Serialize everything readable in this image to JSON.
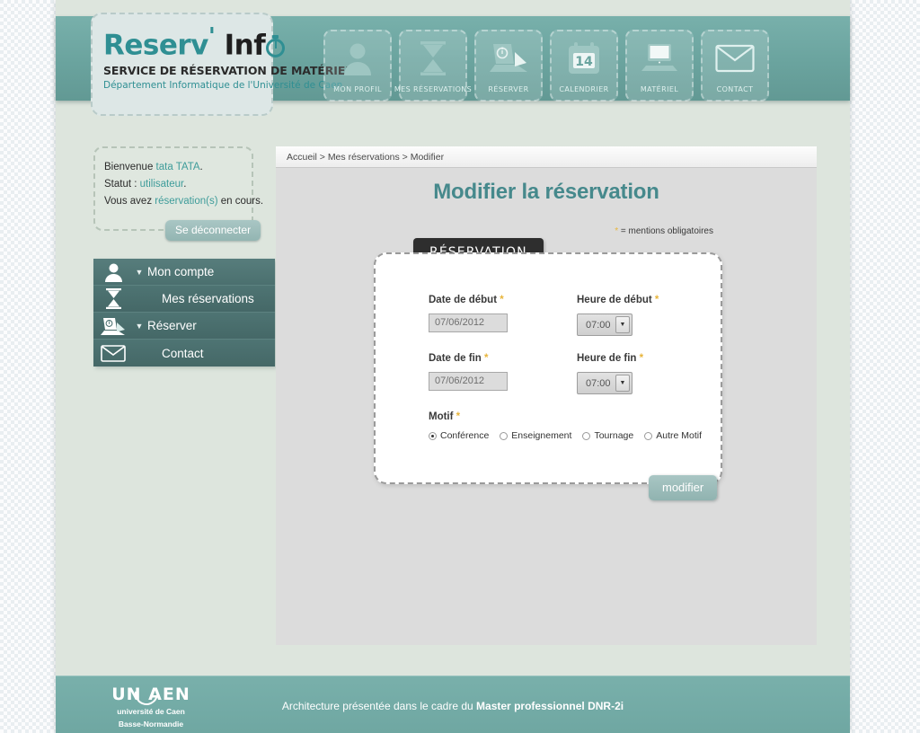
{
  "site": {
    "logo_title_prefix": "Reserv",
    "logo_apostrophe": "'",
    "logo_title_suffix": "Inf",
    "tagline": "SERVICE DE RÉSERVATION DE MATÉRIEL",
    "subtitle": "Département Informatique de l'Université de Caen",
    "accent_color": "#2f8f93",
    "header_color": "#6ba49f",
    "title_color": "#46898c",
    "required_star_color": "#e8b53c"
  },
  "topnav": {
    "items": [
      {
        "label": "Mon profil",
        "icon": "user-icon"
      },
      {
        "label": "Mes réservations",
        "icon": "hourglass-icon"
      },
      {
        "label": "Réserver",
        "icon": "laptop-timer-icon"
      },
      {
        "label": "Calendrier",
        "icon": "calendar-icon",
        "day": "14"
      },
      {
        "label": "Matériel",
        "icon": "monitor-icon"
      },
      {
        "label": "Contact",
        "icon": "envelope-icon"
      }
    ]
  },
  "sidebar": {
    "welcome": {
      "line1_prefix": "Bienvenue ",
      "line1_user": "tata TATA",
      "line1_suffix": ".",
      "line2_prefix": "Statut : ",
      "line2_value": "utilisateur",
      "line2_suffix": ".",
      "line3_prefix": "Vous avez ",
      "line3_value": "réservation(s)",
      "line3_suffix": " en cours."
    },
    "logout_label": "Se déconnecter",
    "menu": [
      {
        "label": "Mon compte",
        "icon": "user-icon",
        "caret": "▼"
      },
      {
        "label": "Mes réservations",
        "icon": "hourglass-icon",
        "caret": ""
      },
      {
        "label": "Réserver",
        "icon": "laptop-timer-icon",
        "caret": "▼"
      },
      {
        "label": "Contact",
        "icon": "envelope-icon",
        "caret": ""
      }
    ]
  },
  "main": {
    "breadcrumb": "Accueil > Mes réservations > Modifier",
    "page_title": "Modifier la réservation",
    "mentions_star": "*",
    "mentions_text": " = mentions obligatoires",
    "form": {
      "tab_label": "Réservation",
      "fields": {
        "date_debut_label": "Date de début",
        "date_debut_value": "07/06/2012",
        "heure_debut_label": "Heure de début",
        "heure_debut_value": "07:00",
        "date_fin_label": "Date de fin",
        "date_fin_value": "07/06/2012",
        "heure_fin_label": "Heure de fin",
        "heure_fin_value": "07:00",
        "motif_label": "Motif"
      },
      "motif_options": [
        {
          "label": "Conférence",
          "selected": true
        },
        {
          "label": "Enseignement",
          "selected": false
        },
        {
          "label": "Tournage",
          "selected": false
        },
        {
          "label": "Autre Motif",
          "selected": false
        }
      ],
      "submit_label": "modifier"
    }
  },
  "footer": {
    "logo_main": "UN AEN",
    "logo_sub_line1": "université de Caen",
    "logo_sub_line2": "Basse-Normandie",
    "text_normal": "Architecture présentée dans le cadre du ",
    "text_bold": "Master professionnel DNR-2i"
  }
}
